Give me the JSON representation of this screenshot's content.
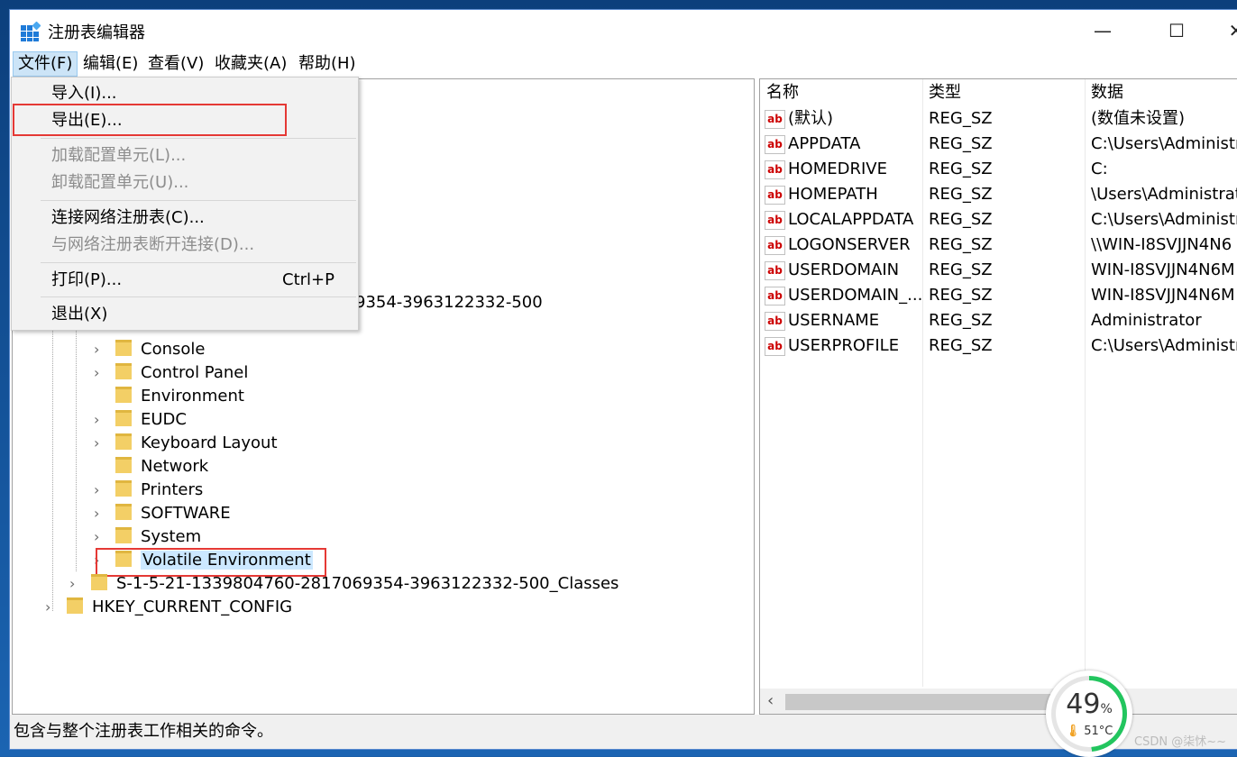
{
  "window": {
    "title": "注册表编辑器",
    "controls": {
      "minimize": "—",
      "maximize": "☐",
      "close": "✕"
    }
  },
  "menubar": [
    "文件(F)",
    "编辑(E)",
    "查看(V)",
    "收藏夹(A)",
    "帮助(H)"
  ],
  "file_menu": {
    "import": "导入(I)...",
    "export": "导出(E)...",
    "load_hive": "加载配置单元(L)...",
    "unload_hive": "卸载配置单元(U)...",
    "connect": "连接网络注册表(C)...",
    "disconnect": "与网络注册表断开连接(D)...",
    "print": "打印(P)...",
    "print_shortcut": "Ctrl+P",
    "exit": "退出(X)"
  },
  "tree": {
    "partial_sid": "9354-3963122332-500",
    "items": [
      "Console",
      "Control Panel",
      "Environment",
      "EUDC",
      "Keyboard Layout",
      "Network",
      "Printers",
      "SOFTWARE",
      "System",
      "Volatile Environment"
    ],
    "classes": "S-1-5-21-1339804760-2817069354-3963122332-500_Classes",
    "hkcc": "HKEY_CURRENT_CONFIG"
  },
  "values": {
    "headers": [
      "名称",
      "类型",
      "数据"
    ],
    "rows": [
      {
        "name": "(默认)",
        "type": "REG_SZ",
        "data": "(数值未设置)"
      },
      {
        "name": "APPDATA",
        "type": "REG_SZ",
        "data": "C:\\Users\\Administra"
      },
      {
        "name": "HOMEDRIVE",
        "type": "REG_SZ",
        "data": "C:"
      },
      {
        "name": "HOMEPATH",
        "type": "REG_SZ",
        "data": "\\Users\\Administrat"
      },
      {
        "name": "LOCALAPPDATA",
        "type": "REG_SZ",
        "data": "C:\\Users\\Administra"
      },
      {
        "name": "LOGONSERVER",
        "type": "REG_SZ",
        "data": "\\\\WIN-I8SVJJN4N6"
      },
      {
        "name": "USERDOMAIN",
        "type": "REG_SZ",
        "data": "WIN-I8SVJJN4N6M"
      },
      {
        "name": "USERDOMAIN_...",
        "type": "REG_SZ",
        "data": "WIN-I8SVJJN4N6M"
      },
      {
        "name": "USERNAME",
        "type": "REG_SZ",
        "data": "Administrator"
      },
      {
        "name": "USERPROFILE",
        "type": "REG_SZ",
        "data": "C:\\Users\\Administra"
      }
    ],
    "icon_text": "ab"
  },
  "status": "包含与整个注册表工作相关的命令。",
  "widget": {
    "percent": "49",
    "percent_sign": "%",
    "temp": "51°C"
  },
  "watermark": "CSDN @柒怵~~"
}
